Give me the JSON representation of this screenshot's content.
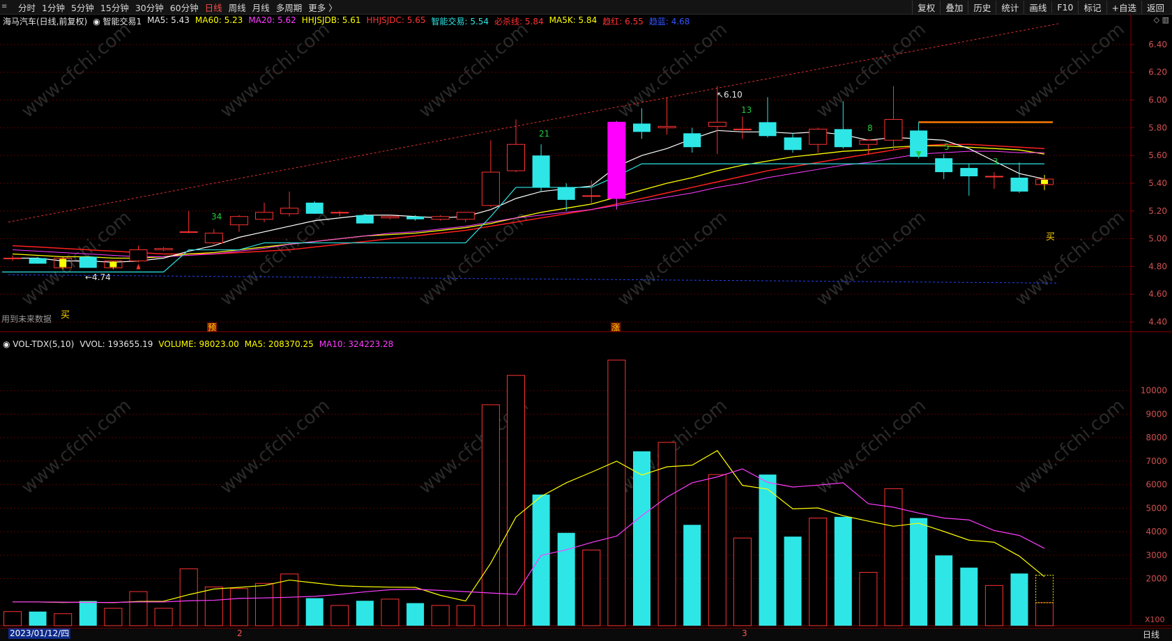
{
  "top_bar": {
    "periods": [
      "分时",
      "1分钟",
      "5分钟",
      "15分钟",
      "30分钟",
      "60分钟",
      "日线",
      "周线",
      "月线",
      "多周期",
      "更多 〉"
    ],
    "active_period": "日线",
    "tools": [
      "复权",
      "叠加",
      "历史",
      "统计",
      "画线",
      "F10",
      "标记",
      "+自选",
      "返回"
    ]
  },
  "legend": [
    {
      "text": "海马汽车(日线,前复权)",
      "color": "#e6e6e6"
    },
    {
      "text": "◉ 智能交易1",
      "color": "#e6e6e6"
    },
    {
      "text": "MA5: 5.43",
      "color": "#e6e6e6"
    },
    {
      "text": "MA60: 5.23",
      "color": "#ffff00"
    },
    {
      "text": "MA20: 5.62",
      "color": "#ff3dff"
    },
    {
      "text": "HHJSJDB: 5.61",
      "color": "#ffff00"
    },
    {
      "text": "HHJSJDC: 5.65",
      "color": "#ff3333"
    },
    {
      "text": "智能交易: 5.54",
      "color": "#2ee6e6"
    },
    {
      "text": "必杀线: 5.84",
      "color": "#ff3333"
    },
    {
      "text": "MA5K: 5.84",
      "color": "#ffff00"
    },
    {
      "text": "趋红: 6.55",
      "color": "#ff3333"
    },
    {
      "text": "趋蓝: 4.68",
      "color": "#3355ff"
    }
  ],
  "volume_legend": [
    {
      "text": "◉ VOL-TDX(5,10)",
      "color": "#e6e6e6"
    },
    {
      "text": "VVOL: 193655.19",
      "color": "#e6e6e6"
    },
    {
      "text": "VOLUME: 98023.00",
      "color": "#ffff00"
    },
    {
      "text": "MA5: 208370.25",
      "color": "#ffff00"
    },
    {
      "text": "MA10: 324223.28",
      "color": "#ff3dff"
    }
  ],
  "price_axis": [
    "6.40",
    "6.20",
    "6.00",
    "5.80",
    "5.60",
    "5.40",
    "5.20",
    "5.00",
    "4.80",
    "4.60",
    "4.40"
  ],
  "volume_axis": [
    "10000",
    "9000",
    "8000",
    "7000",
    "6000",
    "5000",
    "4000",
    "3000",
    "2000"
  ],
  "volume_unit": "X100",
  "status": {
    "date": "2023/01/12/四",
    "period": "日线",
    "months": [
      "2",
      "3"
    ]
  },
  "future_note": "用到未来数据",
  "annotations": {
    "low": "4.74",
    "high": "6.10",
    "buy": "买",
    "yu": "预",
    "zhang": "涨",
    "counts": [
      "34",
      "21",
      "13",
      "8",
      "5",
      "3"
    ]
  },
  "colors": {
    "up": "#ff3333",
    "down": "#2ee6e6",
    "bg": "#000000",
    "grid": "#5a0000"
  },
  "chart_data": {
    "type": "candlestick",
    "candles": [
      {
        "o": 4.86,
        "h": 4.88,
        "l": 4.84,
        "c": 4.86
      },
      {
        "o": 4.86,
        "h": 4.87,
        "l": 4.82,
        "c": 4.82
      },
      {
        "o": 4.79,
        "h": 4.87,
        "l": 4.78,
        "c": 4.86
      },
      {
        "o": 4.87,
        "h": 4.88,
        "l": 4.79,
        "c": 4.79
      },
      {
        "o": 4.79,
        "h": 4.84,
        "l": 4.78,
        "c": 4.84
      },
      {
        "o": 4.84,
        "h": 4.95,
        "l": 4.83,
        "c": 4.92
      },
      {
        "o": 4.92,
        "h": 4.94,
        "l": 4.91,
        "c": 4.93
      },
      {
        "o": 5.05,
        "h": 5.2,
        "l": 5.04,
        "c": 5.05
      },
      {
        "o": 4.97,
        "h": 5.07,
        "l": 4.96,
        "c": 5.04
      },
      {
        "o": 5.1,
        "h": 5.17,
        "l": 5.05,
        "c": 5.16
      },
      {
        "o": 5.14,
        "h": 5.26,
        "l": 5.12,
        "c": 5.19
      },
      {
        "o": 5.18,
        "h": 5.34,
        "l": 5.16,
        "c": 5.22
      },
      {
        "o": 5.26,
        "h": 5.27,
        "l": 5.18,
        "c": 5.18
      },
      {
        "o": 5.19,
        "h": 5.2,
        "l": 5.16,
        "c": 5.19
      },
      {
        "o": 5.17,
        "h": 5.18,
        "l": 5.11,
        "c": 5.11
      },
      {
        "o": 5.15,
        "h": 5.17,
        "l": 5.14,
        "c": 5.16
      },
      {
        "o": 5.16,
        "h": 5.17,
        "l": 5.13,
        "c": 5.14
      },
      {
        "o": 5.14,
        "h": 5.17,
        "l": 5.13,
        "c": 5.16
      },
      {
        "o": 5.14,
        "h": 5.19,
        "l": 5.12,
        "c": 5.19
      },
      {
        "o": 5.24,
        "h": 5.71,
        "l": 5.23,
        "c": 5.48
      },
      {
        "o": 5.49,
        "h": 5.86,
        "l": 5.48,
        "c": 5.68
      },
      {
        "o": 5.6,
        "h": 5.68,
        "l": 5.34,
        "c": 5.37
      },
      {
        "o": 5.37,
        "h": 5.4,
        "l": 5.2,
        "c": 5.28
      },
      {
        "o": 5.31,
        "h": 5.42,
        "l": 5.25,
        "c": 5.31
      },
      {
        "o": 5.29,
        "h": 5.85,
        "l": 5.21,
        "c": 5.84
      },
      {
        "o": 5.83,
        "h": 5.94,
        "l": 5.72,
        "c": 5.77
      },
      {
        "o": 5.8,
        "h": 6.02,
        "l": 5.75,
        "c": 5.81
      },
      {
        "o": 5.76,
        "h": 5.8,
        "l": 5.62,
        "c": 5.66
      },
      {
        "o": 5.81,
        "h": 6.1,
        "l": 5.61,
        "c": 5.84
      },
      {
        "o": 5.79,
        "h": 5.88,
        "l": 5.72,
        "c": 5.79
      },
      {
        "o": 5.84,
        "h": 6.02,
        "l": 5.73,
        "c": 5.74
      },
      {
        "o": 5.73,
        "h": 5.76,
        "l": 5.62,
        "c": 5.64
      },
      {
        "o": 5.68,
        "h": 5.8,
        "l": 5.62,
        "c": 5.79
      },
      {
        "o": 5.79,
        "h": 5.99,
        "l": 5.65,
        "c": 5.66
      },
      {
        "o": 5.68,
        "h": 5.72,
        "l": 5.61,
        "c": 5.71
      },
      {
        "o": 5.71,
        "h": 6.1,
        "l": 5.64,
        "c": 5.86
      },
      {
        "o": 5.78,
        "h": 5.84,
        "l": 5.58,
        "c": 5.59
      },
      {
        "o": 5.58,
        "h": 5.61,
        "l": 5.43,
        "c": 5.48
      },
      {
        "o": 5.51,
        "h": 5.54,
        "l": 5.31,
        "c": 5.45
      },
      {
        "o": 5.45,
        "h": 5.48,
        "l": 5.36,
        "c": 5.45
      },
      {
        "o": 5.44,
        "h": 5.55,
        "l": 5.33,
        "c": 5.34
      },
      {
        "o": 5.39,
        "h": 5.46,
        "l": 5.35,
        "c": 5.43
      }
    ],
    "special": {
      "yellow": [
        2,
        4,
        41
      ],
      "magenta": [
        24
      ]
    },
    "lines": {
      "MA5": [
        4.86,
        4.86,
        4.84,
        4.84,
        4.83,
        4.84,
        4.86,
        4.91,
        4.95,
        5.01,
        5.05,
        5.09,
        5.13,
        5.15,
        5.17,
        5.17,
        5.16,
        5.15,
        5.16,
        5.21,
        5.29,
        5.34,
        5.36,
        5.38,
        5.52,
        5.6,
        5.65,
        5.72,
        5.78,
        5.77,
        5.77,
        5.76,
        5.77,
        5.75,
        5.71,
        5.73,
        5.72,
        5.71,
        5.65,
        5.56,
        5.47,
        5.43
      ],
      "MA20": [
        4.92,
        4.91,
        4.9,
        4.89,
        4.88,
        4.87,
        4.87,
        4.88,
        4.89,
        4.91,
        4.93,
        4.96,
        4.98,
        5.0,
        5.02,
        5.04,
        5.05,
        5.07,
        5.09,
        5.12,
        5.15,
        5.17,
        5.19,
        5.21,
        5.24,
        5.27,
        5.3,
        5.33,
        5.37,
        5.4,
        5.44,
        5.47,
        5.5,
        5.53,
        5.55,
        5.58,
        5.61,
        5.62,
        5.63,
        5.63,
        5.62,
        5.62
      ],
      "MA60": [
        4.89,
        4.88,
        4.87,
        4.87,
        4.86,
        4.86,
        4.87,
        4.89,
        4.9,
        4.92,
        4.94,
        4.96,
        4.98,
        5.0,
        5.02,
        5.03,
        5.04,
        5.06,
        5.08,
        5.11,
        5.15,
        5.19,
        5.22,
        5.25,
        5.3,
        5.35,
        5.4,
        5.44,
        5.49,
        5.53,
        5.56,
        5.59,
        5.61,
        5.63,
        5.64,
        5.66,
        5.67,
        5.67,
        5.66,
        5.65,
        5.64,
        5.61
      ],
      "HHJSJDC": [
        4.95,
        4.94,
        4.93,
        4.92,
        4.91,
        4.9,
        4.89,
        4.89,
        4.89,
        4.9,
        4.91,
        4.92,
        4.94,
        4.96,
        4.98,
        5.0,
        5.02,
        5.04,
        5.06,
        5.09,
        5.12,
        5.15,
        5.18,
        5.21,
        5.25,
        5.29,
        5.33,
        5.37,
        5.41,
        5.45,
        5.49,
        5.52,
        5.55,
        5.58,
        5.61,
        5.64,
        5.67,
        5.68,
        5.68,
        5.67,
        5.66,
        5.65
      ],
      "trade_line": [
        4.76,
        4.76,
        4.76,
        4.76,
        4.76,
        4.76,
        4.76,
        4.92,
        4.92,
        4.92,
        4.97,
        4.97,
        4.97,
        4.97,
        4.97,
        4.97,
        4.97,
        4.97,
        4.97,
        5.16,
        5.37,
        5.37,
        5.37,
        5.37,
        5.45,
        5.54,
        5.54,
        5.54,
        5.54,
        5.54,
        5.54,
        5.54,
        5.54,
        5.54,
        5.54,
        5.54,
        5.54,
        5.54,
        5.54,
        5.54,
        5.54,
        5.54
      ],
      "trend_red": [
        5.12,
        6.55
      ],
      "trend_blue": [
        4.74,
        4.68
      ],
      "kill_line": {
        "from": 36,
        "to": 41,
        "value": 5.84
      }
    },
    "volume": [
      600,
      600,
      510,
      1050,
      740,
      1450,
      740,
      2420,
      1650,
      1580,
      1800,
      2200,
      1170,
      860,
      1060,
      1130,
      960,
      860,
      860,
      9400,
      10650,
      5580,
      3950,
      3220,
      11300,
      7420,
      7800,
      4290,
      6430,
      3730,
      6430,
      3790,
      4580,
      4630,
      2270,
      5830,
      4580,
      2990,
      2470,
      1710,
      2220,
      980
    ],
    "volume_ma5": [
      1010,
      1010,
      990,
      1000,
      980,
      1030,
      1040,
      1320,
      1560,
      1630,
      1710,
      1940,
      1820,
      1700,
      1660,
      1640,
      1630,
      1290,
      1050,
      2660,
      4620,
      5500,
      6080,
      6530,
      7000,
      6410,
      6760,
      6830,
      7450,
      5970,
      5810,
      4970,
      5010,
      4680,
      4450,
      4230,
      4360,
      4010,
      3640,
      3550,
      2960,
      2080
    ],
    "volume_ma10": [
      1010,
      1010,
      1000,
      990,
      990,
      1010,
      1010,
      1060,
      1080,
      1160,
      1180,
      1210,
      1250,
      1330,
      1440,
      1530,
      1550,
      1500,
      1450,
      1390,
      1330,
      2990,
      3230,
      3540,
      3810,
      4680,
      5470,
      6080,
      6330,
      6670,
      6100,
      5900,
      5980,
      6080,
      5190,
      5040,
      4790,
      4580,
      4500,
      4050,
      3840,
      3290
    ]
  }
}
